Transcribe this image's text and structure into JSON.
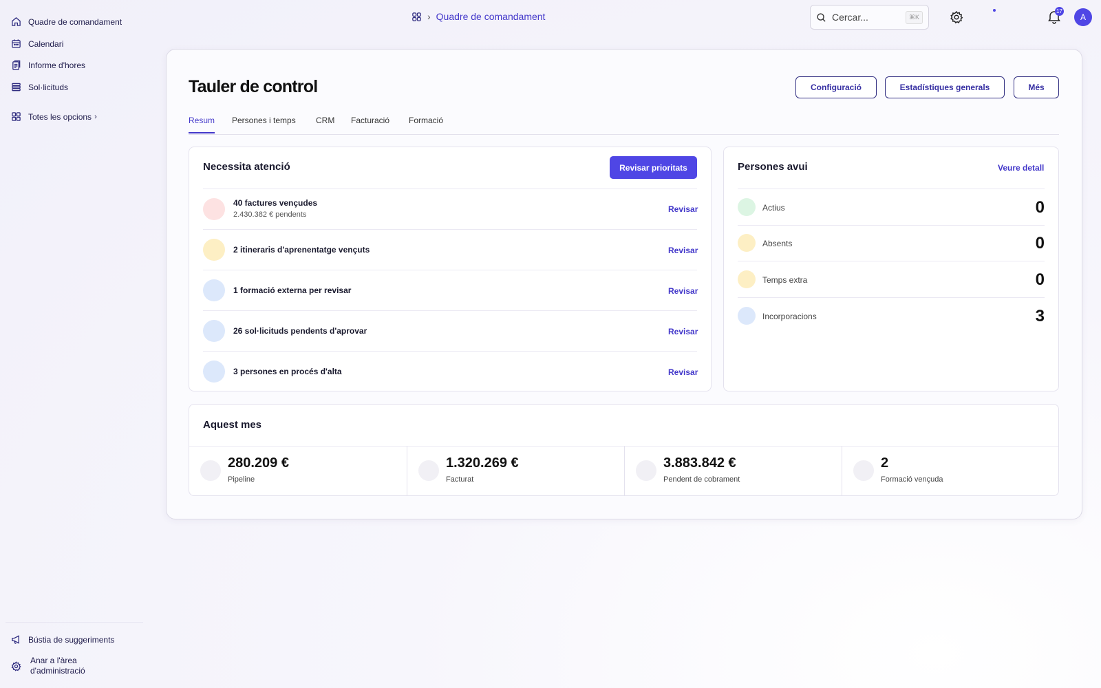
{
  "sidebar": {
    "items": [
      {
        "label": "Quadre de comandament",
        "icon": "home-icon"
      },
      {
        "label": "Calendari",
        "icon": "calendar-icon"
      },
      {
        "label": "Informe d'hores",
        "icon": "report-icon"
      },
      {
        "label": "Sol·licituds",
        "icon": "list-icon"
      }
    ],
    "all_options": "Totes les opcions",
    "bottom": [
      {
        "label": "Bústia de suggeriments",
        "icon": "megaphone-icon"
      },
      {
        "label": "Anar a l'àrea d'administració",
        "icon": "gear-icon"
      }
    ]
  },
  "header": {
    "breadcrumb": "Quadre de comandament",
    "search_placeholder": "Cercar...",
    "search_shortcut": "⌘K",
    "notifications_count": "17",
    "avatar_initial": "A"
  },
  "page": {
    "title": "Tauler de control",
    "actions": [
      "Configuració",
      "Estadístiques generals",
      "Més"
    ],
    "tabs": [
      "Resum",
      "Persones i temps",
      "CRM",
      "Facturació",
      "Formació"
    ],
    "active_tab": "Resum"
  },
  "attention": {
    "title": "Necessita atenció",
    "action": "Revisar prioritats",
    "items": [
      {
        "title": "40 factures vençudes",
        "subtitle": "2.430.382 € pendents",
        "link": "Revisar",
        "color": "#fde2e2"
      },
      {
        "title": "2 itineraris d'aprenentatge vençuts",
        "link": "Revisar",
        "color": "#fdefc4"
      },
      {
        "title": "1 formació externa per revisar",
        "link": "Revisar",
        "color": "#dce8fb"
      },
      {
        "title": "26 sol·licituds pendents d'aprovar",
        "link": "Revisar",
        "color": "#dce8fb"
      },
      {
        "title": "3 persones en procés d'alta",
        "link": "Revisar",
        "color": "#dce8fb"
      }
    ]
  },
  "people": {
    "title": "Persones avui",
    "link": "Veure detall",
    "items": [
      {
        "label": "Actius",
        "value": "0",
        "color": "#dcf5e3"
      },
      {
        "label": "Absents",
        "value": "0",
        "color": "#fdefc4"
      },
      {
        "label": "Temps extra",
        "value": "0",
        "color": "#fdefc4"
      },
      {
        "label": "Incorporacions",
        "value": "3",
        "color": "#dce8fb"
      }
    ]
  },
  "month": {
    "title": "Aquest mes",
    "stats": [
      {
        "value": "280.209 €",
        "label": "Pipeline"
      },
      {
        "value": "1.320.269 €",
        "label": "Facturat"
      },
      {
        "value": "3.883.842 €",
        "label": "Pendent de cobrament"
      },
      {
        "value": "2",
        "label": "Formació vençuda"
      }
    ]
  }
}
